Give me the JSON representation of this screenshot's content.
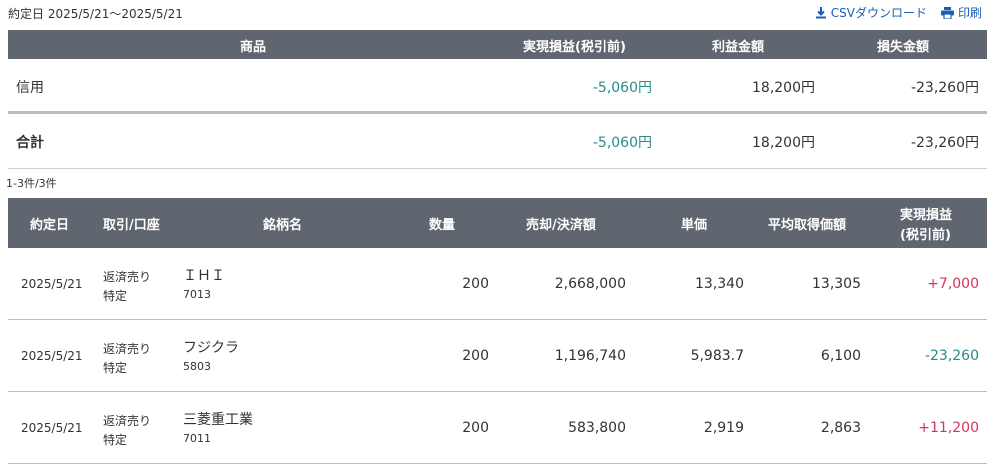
{
  "header": {
    "date_range": "約定日 2025/5/21〜2025/5/21",
    "csv_label": "CSVダウンロード",
    "print_label": "印刷"
  },
  "summary": {
    "columns": [
      "商品",
      "実現損益(税引前)",
      "利益金額",
      "損失金額"
    ],
    "rows": [
      {
        "label": "信用",
        "realized": "-5,060円",
        "profit": "18,200円",
        "loss": "-23,260円"
      },
      {
        "label": "合計",
        "realized": "-5,060円",
        "profit": "18,200円",
        "loss": "-23,260円"
      }
    ]
  },
  "count_text": "1-3件/3件",
  "trades": {
    "columns": {
      "date": "約定日",
      "account": "取引/口座",
      "name": "銘柄名",
      "qty": "数量",
      "amount": "売却/決済額",
      "price": "単価",
      "avg_cost": "平均取得価額",
      "pnl_line1": "実現損益",
      "pnl_line2": "(税引前)"
    },
    "rows": [
      {
        "date": "2025/5/21",
        "type": "返済売り",
        "account": "特定",
        "name": "ＩＨＩ",
        "code": "7013",
        "qty": "200",
        "amount": "2,668,000",
        "price": "13,340",
        "avg_cost": "13,305",
        "pnl": "+7,000"
      },
      {
        "date": "2025/5/21",
        "type": "返済売り",
        "account": "特定",
        "name": "フジクラ",
        "code": "5803",
        "qty": "200",
        "amount": "1,196,740",
        "price": "5,983.7",
        "avg_cost": "6,100",
        "pnl": "-23,260"
      },
      {
        "date": "2025/5/21",
        "type": "返済売り",
        "account": "特定",
        "name": "三菱重工業",
        "code": "7011",
        "qty": "200",
        "amount": "583,800",
        "price": "2,919",
        "avg_cost": "2,863",
        "pnl": "+11,200"
      }
    ]
  },
  "colors": {
    "header_bg": "#606670",
    "link": "#1a5fb4",
    "negative": "#2a8a8a",
    "positive": "#d0375a"
  }
}
